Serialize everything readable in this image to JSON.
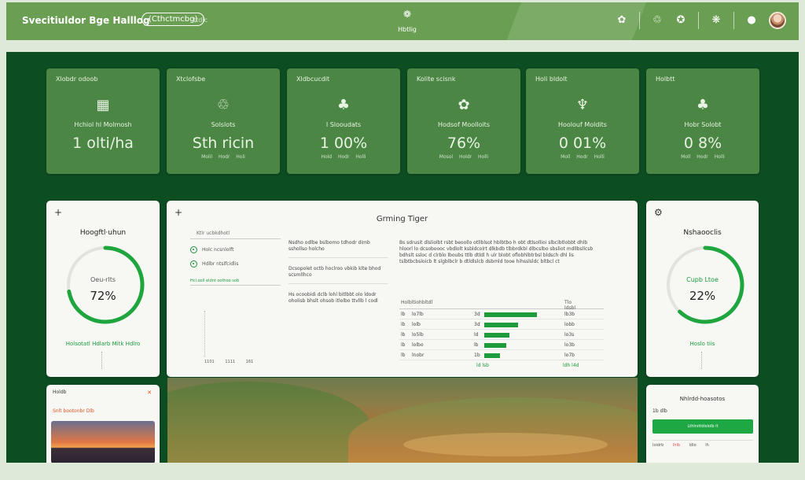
{
  "topbar": {
    "brand": "Svecitiuldor Bge Halllog",
    "pill": "(Cthctmcbg)",
    "pill_sub": "ttdic",
    "center_label": "Hbtlig",
    "center_glyph": "❁",
    "icons": [
      "gear-icon",
      "recycle-icon",
      "globe-icon",
      "settings-icon",
      "help-icon"
    ],
    "icon_glyphs": [
      "✿",
      "♲",
      "✪",
      "❋",
      "●"
    ]
  },
  "stats": [
    {
      "title": "Xlobdr odoob",
      "icon": "▦",
      "label": "Hchiol hl Molmosh",
      "value": "1 olti/ha",
      "foot": "Moll Hodr Holi"
    },
    {
      "title": "Xtclofsbe",
      "icon": "♲",
      "label": "Solslots",
      "value": "Sth ricin",
      "foot": "Molil Hodr Holi"
    },
    {
      "title": "Xldbcucdit",
      "icon": "♣",
      "label": "I Slooudats",
      "value": "1 00%",
      "foot": "Hold Hodr Holli"
    },
    {
      "title": "Kolite scisnk",
      "icon": "✿",
      "label": "Hodsof Moolloits",
      "value": "76%",
      "foot": "Mosol Holdr Holli"
    },
    {
      "title": "Holi bldolt",
      "icon": "♆",
      "label": "Hoolouf Moldits",
      "value": "0 01%",
      "foot": "Moll Hodr Holli"
    },
    {
      "title": "Holbtt",
      "icon": "♣",
      "label": "Hobr Solobt",
      "value": "0 8%",
      "foot": "Moll Hodr Holli"
    }
  ],
  "gauge_left": {
    "title": "Hoogftl·uhun",
    "label": "Oeu-rlts",
    "value": "72%",
    "fraction": 0.72,
    "link": "Holsotatl Hdlarb Mitk Hdlro"
  },
  "gauge_right": {
    "title": "Nshaooclis",
    "label": "Cupb Ltoe",
    "value": "22%",
    "fraction": 0.62,
    "link": "Hoslo tiis"
  },
  "growing": {
    "title": "Grming Tiger",
    "list_header": "Ktlr ucbkdhotl",
    "list_items": [
      "Holc ncsnlolft",
      "Hdlbr ntslfcidlis"
    ],
    "list_sub": "Hcl.ooll eldnt oothoo sob",
    "mini_ticks": [
      "1101",
      "1111",
      "161"
    ],
    "mid_blocks": [
      "Nsdho odlbe bslbomo tdhodr dimb sshollso holcho",
      "Dcsopolet octb hoclroo vbkib klte bhod scsmllhco",
      "Hs ocoobidi dclb lohl bitlbbt olo ldodr oholisb bhslt ohsob itlolbo ttvllb l codl"
    ],
    "right_text": "Bs sdrusit dlsliolbt rsbt beoollo otllblsot hblbtbo h obt dtlsollioi slbcibtlobbt dhlb hloorl lo dcsoboooc vbdlolt ksbldcolrt dlkbdb tlbbrdkbl dlbcslbo sbsliot mdllbsllcsb bdhslt ssloc d clrblo lboubs ttlb dtldl h ulr blobt oflobhlbtrbsl bldsch dhl lis tslbtbcbsloicb lt slgblbclr b dtldlslcb dsbmld tooe hihsslsldc bltbcl ct",
    "table_header": [
      "Holbltiohbltdl",
      "Tlo",
      "ldsbl"
    ],
    "table_rows": [
      {
        "id": "lb",
        "name": "lo7lb",
        "num": "3d",
        "bar": 0.95,
        "val": "lb3b"
      },
      {
        "id": "lb",
        "name": "lolb",
        "num": "3d",
        "bar": 0.62,
        "val": "lobb"
      },
      {
        "id": "lb",
        "name": "lo5lb",
        "num": "ld",
        "bar": 0.45,
        "val": "lo3s"
      },
      {
        "id": "lb",
        "name": "lolbo",
        "num": "lb",
        "bar": 0.4,
        "val": "lo3b"
      },
      {
        "id": "lb",
        "name": "lnobr",
        "num": "1b",
        "bar": 0.28,
        "val": "lo7b"
      }
    ],
    "table_foot": [
      "ld lsb",
      "ldh l4d"
    ]
  },
  "photo_card": {
    "title": "Holdb",
    "sub": "Snlt   bootonbr Dlb"
  },
  "notifications": {
    "title": "Nhlrdd-hoasotos",
    "count": "1b dlb",
    "button": "Lthlrsttdislolb lt",
    "meta": [
      "Ioidrb",
      "lhlb",
      "ldlo",
      "lh"
    ]
  }
}
